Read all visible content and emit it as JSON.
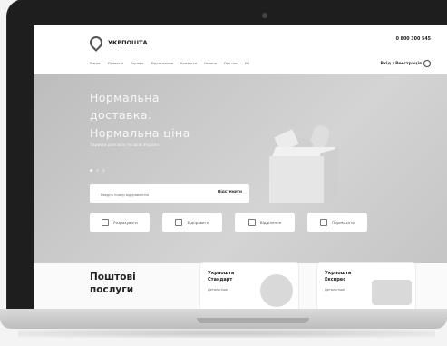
{
  "site": {
    "logo_name": "УКРПОШТА",
    "phone_number": "0 800 300 545",
    "nav": [
      "Бізнес",
      "Приватні",
      "Тарифи",
      "Відстеження",
      "Контакти",
      "Новини",
      "Про нас",
      "EN"
    ],
    "language": "Вхід / Реєстрація"
  },
  "hero": {
    "title_line1": "Нормальна",
    "title_line2": "доставка.",
    "title_line3": "Нормальна ціна",
    "subtitle": "Тарифи для всіх по всій Україні",
    "track_placeholder": "Введіть номер відправлення",
    "track_button": "Відстежити"
  },
  "services": [
    {
      "label": "Розрахувати",
      "icon": "calculator-icon"
    },
    {
      "label": "Відправити",
      "icon": "parcel-icon"
    },
    {
      "label": "Відділення",
      "icon": "location-icon"
    },
    {
      "label": "Переказати",
      "icon": "money-icon"
    }
  ],
  "postal": {
    "title_line1": "Поштові",
    "title_line2": "послуги"
  },
  "cards": [
    {
      "title_line1": "Укрпошта",
      "title_line2": "Стандарт",
      "note": "Детальніше"
    },
    {
      "title_line1": "Укрпошта",
      "title_line2": "Експрес",
      "note": "Детальніше"
    }
  ],
  "colors": {
    "laptop_frame": "#1e1e1e",
    "hero_bg": "#c5c5c5",
    "card_bg": "#ffffff"
  }
}
